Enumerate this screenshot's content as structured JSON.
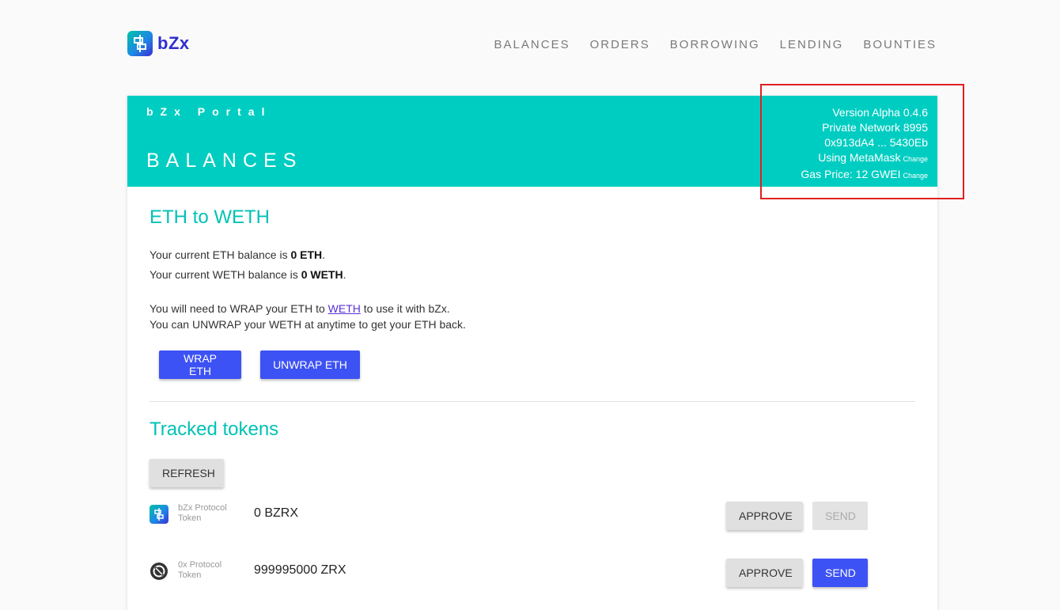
{
  "header": {
    "logo_text": "bZx",
    "nav": [
      "BALANCES",
      "ORDERS",
      "BORROWING",
      "LENDING",
      "BOUNTIES"
    ]
  },
  "banner": {
    "portal": "bZx Portal",
    "title": "BALANCES",
    "version": "Version Alpha 0.4.6",
    "network": "Private Network 8995",
    "address": "0x913dA4 ... 5430Eb",
    "provider": "Using MetaMask",
    "gas": "Gas Price: 12 GWEI",
    "change_label": "Change"
  },
  "weth": {
    "title": "ETH to WETH",
    "eth_prefix": "Your current ETH balance is ",
    "eth_value": "0 ETH",
    "weth_prefix": "Your current WETH balance is ",
    "weth_value": "0 WETH",
    "wrap_prefix": "You will need to WRAP your ETH to ",
    "wrap_link": "WETH",
    "wrap_suffix": " to use it with bZx.",
    "unwrap_note": "You can UNWRAP your WETH at anytime to get your ETH back.",
    "wrap_button": "WRAP ETH",
    "unwrap_button": "UNWRAP ETH"
  },
  "tracked": {
    "title": "Tracked tokens",
    "refresh_button": "REFRESH",
    "tokens": [
      {
        "name": "bZx Protocol Token",
        "amount": "0 BZRX",
        "approve": "APPROVE",
        "send": "SEND",
        "send_enabled": false,
        "icon": "bzx-logo-icon"
      },
      {
        "name": "0x Protocol Token",
        "amount": "999995000 ZRX",
        "approve": "APPROVE",
        "send": "SEND",
        "send_enabled": true,
        "icon": "zrx-logo-icon"
      }
    ]
  },
  "colors": {
    "accent": "#00cdc1",
    "primary_button": "#3d52f4",
    "highlight": "#e02020"
  }
}
